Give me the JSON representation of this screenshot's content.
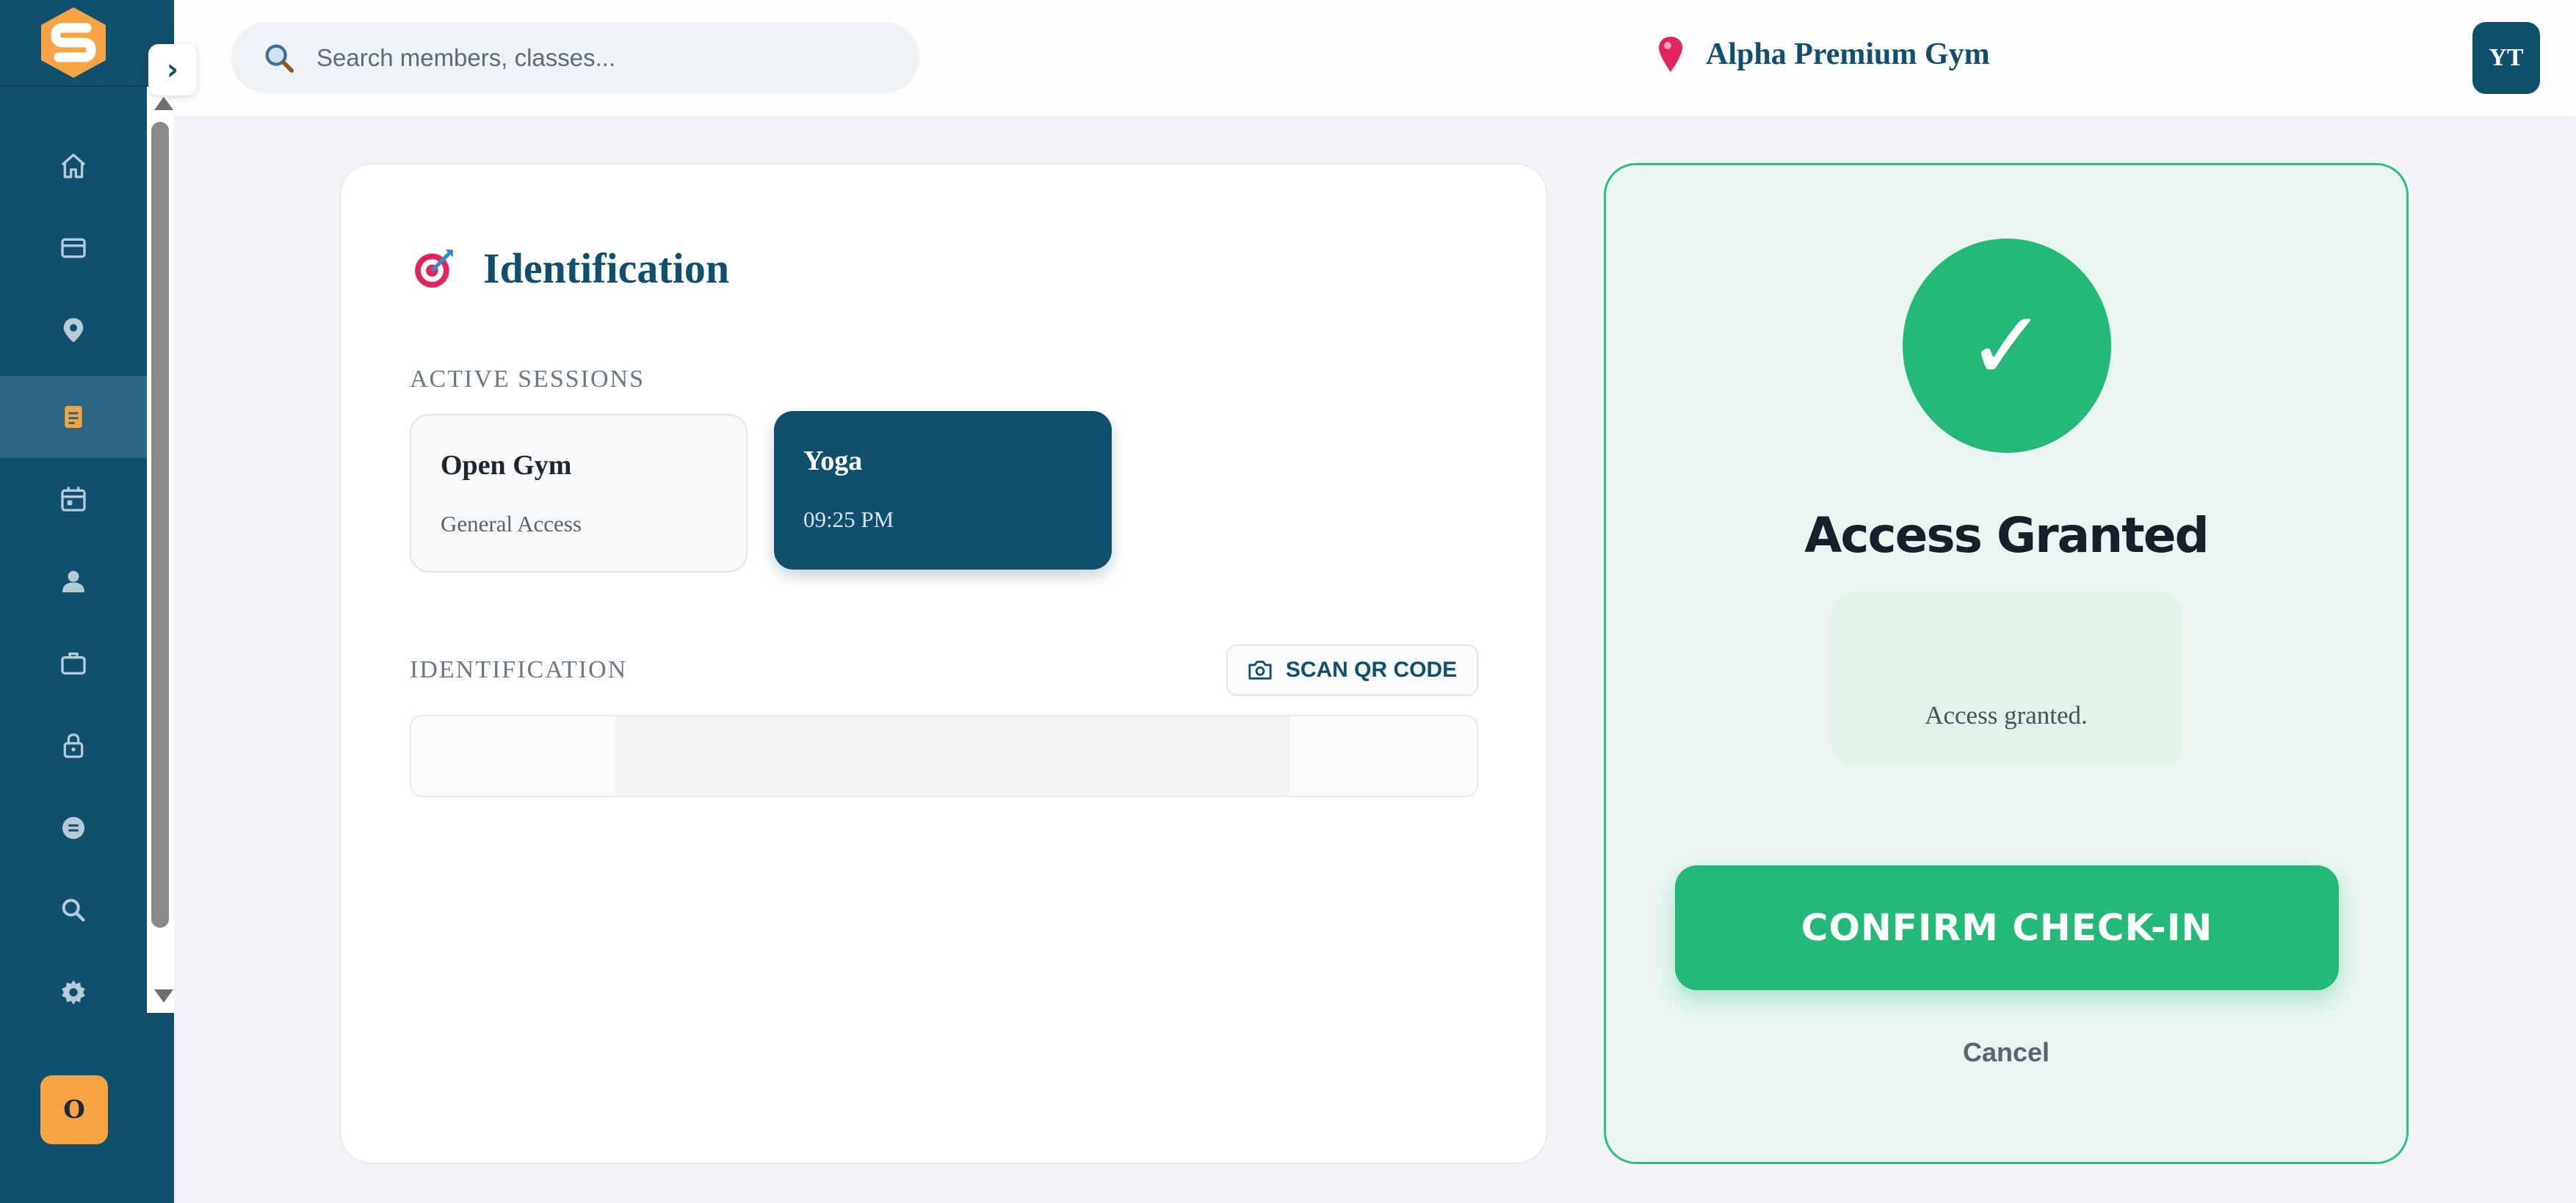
{
  "sidebar": {
    "collapse_label": "›",
    "nav_items": [
      {
        "name": "home",
        "icon": "home-icon",
        "active": false
      },
      {
        "name": "billing",
        "icon": "card-icon",
        "active": false
      },
      {
        "name": "locations",
        "icon": "map-pin-icon",
        "active": false
      },
      {
        "name": "check-in",
        "icon": "clipboard-icon",
        "active": true
      },
      {
        "name": "calendar",
        "icon": "calendar-icon",
        "active": false
      },
      {
        "name": "members",
        "icon": "user-icon",
        "active": false
      },
      {
        "name": "staff",
        "icon": "briefcase-icon",
        "active": false
      },
      {
        "name": "security",
        "icon": "lock-icon",
        "active": false
      },
      {
        "name": "messages",
        "icon": "chat-icon",
        "active": false
      },
      {
        "name": "search",
        "icon": "search-icon",
        "active": false
      },
      {
        "name": "settings",
        "icon": "gear-icon",
        "active": false
      }
    ],
    "user_initial": "O"
  },
  "header": {
    "search_placeholder": "Search members, classes...",
    "location_name": "Alpha Premium Gym",
    "avatar_initials": "YT"
  },
  "identification": {
    "title": "Identification",
    "sessions_label": "ACTIVE SESSIONS",
    "sessions": [
      {
        "name": "Open Gym",
        "sub": "General Access",
        "selected": false
      },
      {
        "name": "Yoga",
        "sub": "09:25 PM",
        "selected": true
      }
    ],
    "id_label": "IDENTIFICATION",
    "scan_label": "SCAN QR CODE",
    "id_value": ""
  },
  "access": {
    "check_glyph": "✓",
    "title": "Access Granted",
    "message": "Access granted.",
    "confirm_label": "CONFIRM CHECK-IN",
    "cancel_label": "Cancel"
  },
  "colors": {
    "brand": "#114f6e",
    "success": "#24b879",
    "accent": "#f7a544"
  }
}
